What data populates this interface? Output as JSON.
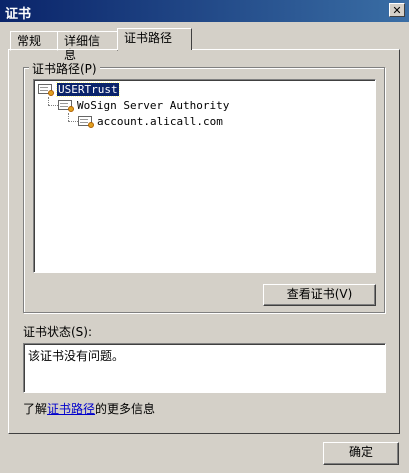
{
  "window": {
    "title": "证书",
    "close_label": "✕"
  },
  "tabs": [
    {
      "label": "常规"
    },
    {
      "label": "详细信息"
    },
    {
      "label": "证书路径"
    }
  ],
  "path_group": {
    "label": "证书路径(P)",
    "tree": [
      {
        "label": "USERTrust",
        "selected": true
      },
      {
        "label": "WoSign Server Authority"
      },
      {
        "label": "account.alicall.com"
      }
    ],
    "view_cert_button": "查看证书(V)"
  },
  "status": {
    "label": "证书状态(S):",
    "text": "该证书没有问题。"
  },
  "more_info": {
    "prefix": "了解",
    "link": "证书路径",
    "suffix": "的更多信息"
  },
  "ok_button": "确定"
}
